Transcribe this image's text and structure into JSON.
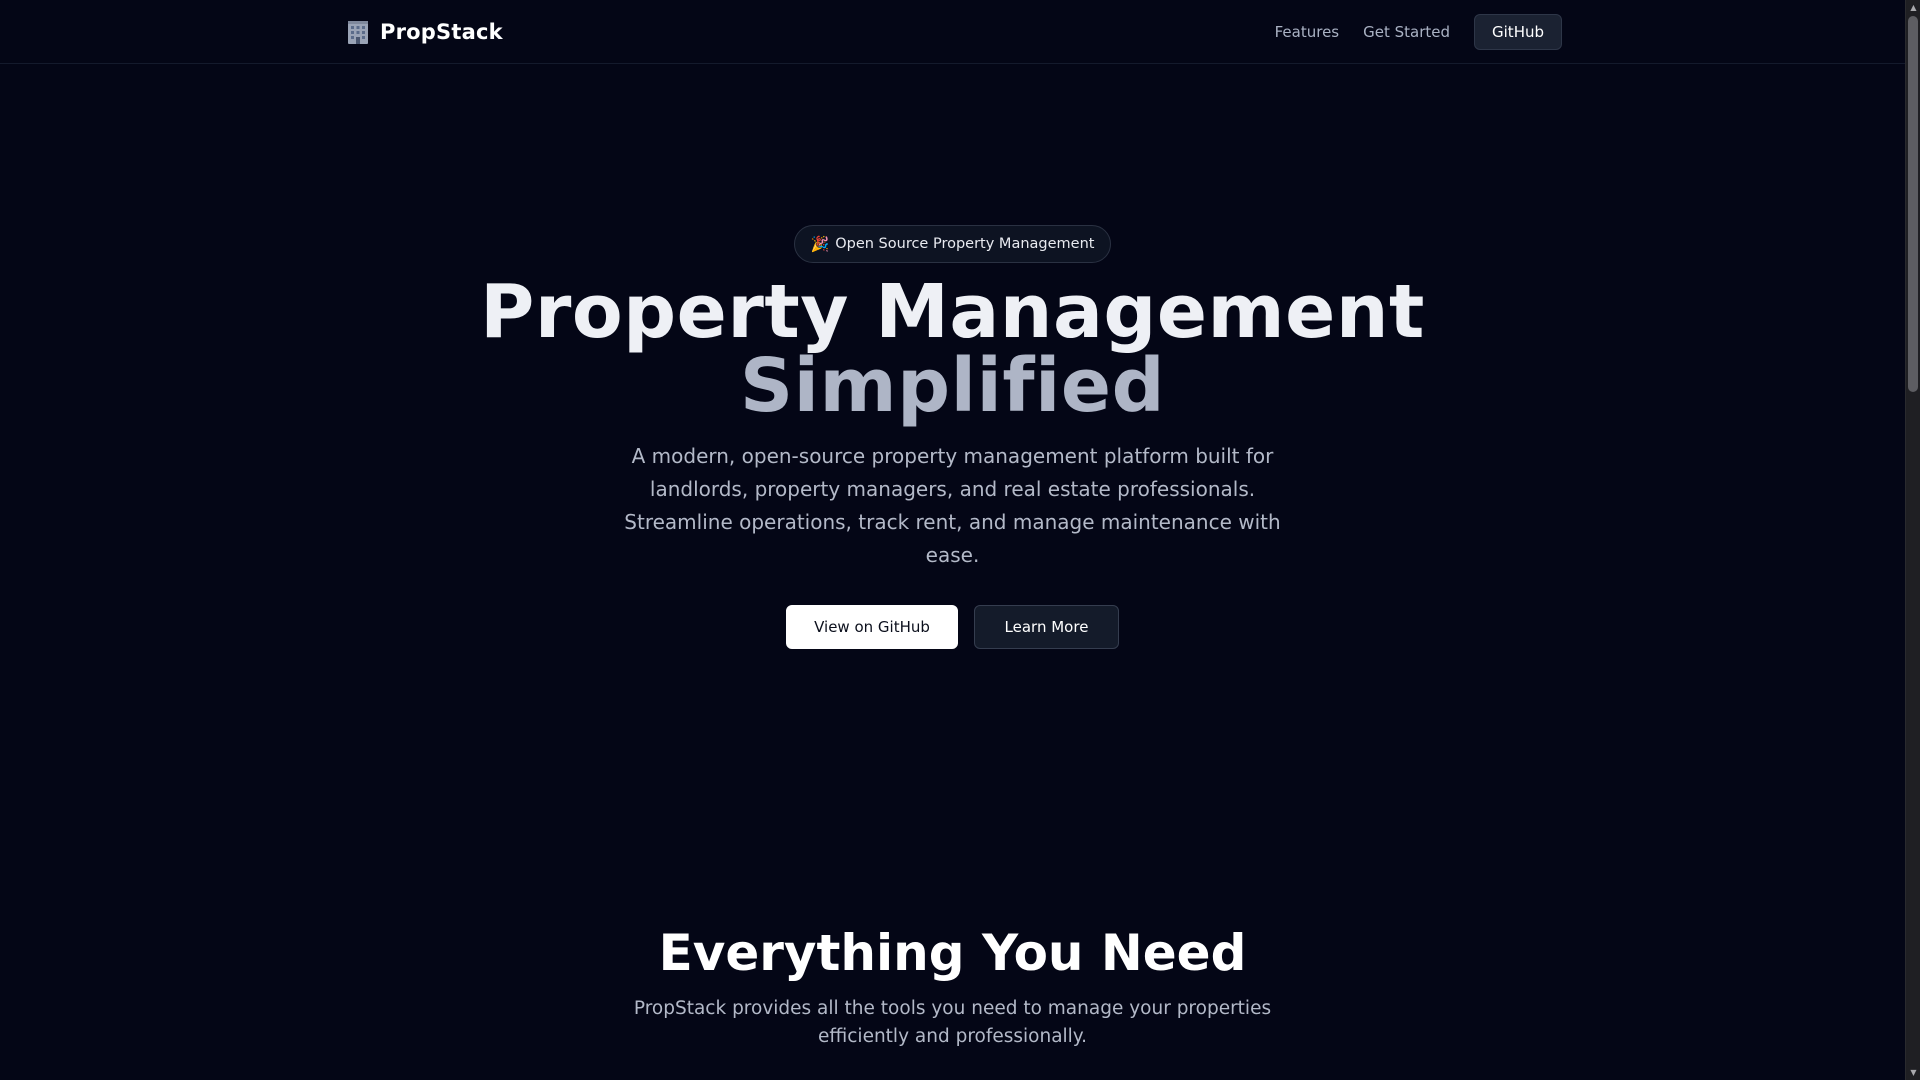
{
  "header": {
    "brand_name": "PropStack",
    "brand_icon": "office-building-icon",
    "nav_links": [
      "Features",
      "Get Started"
    ],
    "github_button": "GitHub"
  },
  "hero": {
    "badge_icon": "🎉",
    "badge_text": "Open Source Property Management",
    "title_line1": "Property Management",
    "title_line2": "Simplified",
    "description": "A modern, open-source property management platform built for landlords, property managers, and real estate professionals. Streamline operations, track rent, and manage maintenance with ease.",
    "primary_button": "View on GitHub",
    "secondary_button": "Learn More"
  },
  "features": {
    "title": "Everything You Need",
    "description": "PropStack provides all the tools you need to manage your properties efficiently and professionally."
  },
  "colors": {
    "background": "#040616",
    "title_primary": "#eef0f5",
    "title_secondary": "#aeb5c6",
    "muted_text": "#b3b9c8",
    "button_dark": "#1b2232"
  }
}
